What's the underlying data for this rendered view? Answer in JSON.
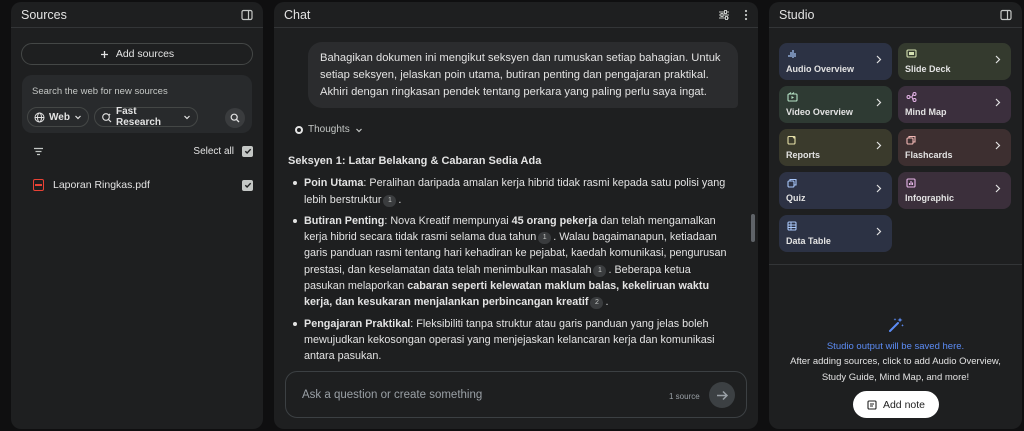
{
  "sources": {
    "title": "Sources",
    "add_sources_label": "Add sources",
    "search_placeholder": "Search the web for new sources",
    "web_chip": "Web",
    "research_chip": "Fast Research",
    "select_all_label": "Select all",
    "items": [
      {
        "name": "Laporan Ringkas.pdf",
        "checked": true
      }
    ]
  },
  "chat": {
    "title": "Chat",
    "user_message": "Bahagikan dokumen ini mengikut seksyen dan rumuskan setiap bahagian. Untuk setiap seksyen, jelaskan poin utama, butiran penting dan pengajaran praktikal. Akhiri dengan ringkasan pendek tentang perkara yang paling perlu saya ingat.",
    "thoughts_label": "Thoughts",
    "response": {
      "heading": "Seksyen 1: Latar Belakang & Cabaran Sedia Ada",
      "b1_label": "Poin Utama",
      "b1_text": ": Peralihan daripada amalan kerja hibrid tidak rasmi kepada satu polisi yang lebih berstruktur",
      "b1_cite": "1",
      "b2_label": "Butiran Penting",
      "b2_t1": ": Nova Kreatif mempunyai ",
      "b2_bold1": "45 orang pekerja",
      "b2_t2": " dan telah mengamalkan kerja hibrid secara tidak rasmi selama dua tahun",
      "b2_cite1": "1",
      "b2_t3": ". Walau bagaimanapun, ketiadaan garis panduan rasmi tentang hari kehadiran ke pejabat, kaedah komunikasi, pengurusan prestasi, dan keselamatan data telah menimbulkan masalah",
      "b2_cite2": "1",
      "b2_t4": ". Beberapa ketua pasukan melaporkan ",
      "b2_bold2": "cabaran seperti kelewatan maklum balas, kekeliruan waktu kerja, dan kesukaran menjalankan perbincangan kreatif",
      "b2_cite3": "2",
      "b3_label": "Pengajaran Praktikal",
      "b3_text": ": Fleksibiliti tanpa struktur atau garis panduan yang jelas boleh mewujudkan kekosongan operasi yang menjejaskan kelancaran kerja dan komunikasi antara pasukan."
    },
    "composer_placeholder": "Ask a question or create something",
    "source_count": "1 source"
  },
  "studio": {
    "title": "Studio",
    "tiles": {
      "audio": "Audio Overview",
      "slide": "Slide Deck",
      "video": "Video Overview",
      "mind": "Mind Map",
      "reports": "Reports",
      "flash": "Flashcards",
      "quiz": "Quiz",
      "info": "Infographic",
      "table": "Data Table"
    },
    "empty_title": "Studio output will be saved here.",
    "empty_desc_1": "After adding sources, click to add Audio Overview,",
    "empty_desc_2": "Study Guide, Mind Map, and more!",
    "add_note_label": "Add note"
  }
}
